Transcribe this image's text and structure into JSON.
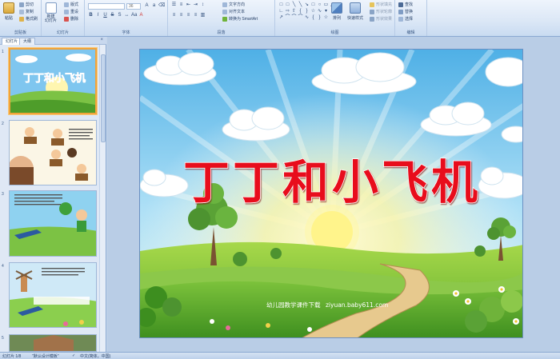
{
  "ribbon": {
    "clipboard": {
      "paste": "粘贴",
      "cut": "剪切",
      "copy": "复制",
      "format_painter": "格式刷",
      "label": "剪贴板"
    },
    "slides": {
      "new_slide": "新建\n幻灯片",
      "layout": "版式",
      "reset": "重设",
      "delete": "删除",
      "label": "幻灯片"
    },
    "font": {
      "font_size": "36",
      "label": "字体"
    },
    "paragraph": {
      "text_direction": "文字方向",
      "align_text": "对齐文本",
      "smartart": "转换为 SmartArt",
      "label": "段落"
    },
    "drawing": {
      "arrange": "排列",
      "quick_styles": "快速样式",
      "shape_fill": "形状填充",
      "shape_outline": "形状轮廓",
      "shape_effects": "形状效果",
      "label": "绘图"
    },
    "editing": {
      "find": "查找",
      "replace": "替换",
      "select": "选择",
      "label": "编辑"
    }
  },
  "leftpane": {
    "tab_slides": "幻灯片",
    "tab_outline": "大纲",
    "close_glyph": "×",
    "thumbnails": [
      {
        "num": "1",
        "title": "丁丁和小飞机"
      },
      {
        "num": "2"
      },
      {
        "num": "3"
      },
      {
        "num": "4"
      },
      {
        "num": "5"
      }
    ]
  },
  "slide": {
    "title": "丁丁和小飞机",
    "footer": "幼儿园教学课件下载",
    "footer_link": "ziyuan.baby611.com"
  },
  "status": {
    "slide_count": "幻灯片 1/8",
    "theme": "\"默认设计模板\"",
    "language": "中文(简体，中国)"
  },
  "colors": {
    "title_red": "#e8101a",
    "sky": "#5fb7e8",
    "grass": "#6fb33a"
  }
}
